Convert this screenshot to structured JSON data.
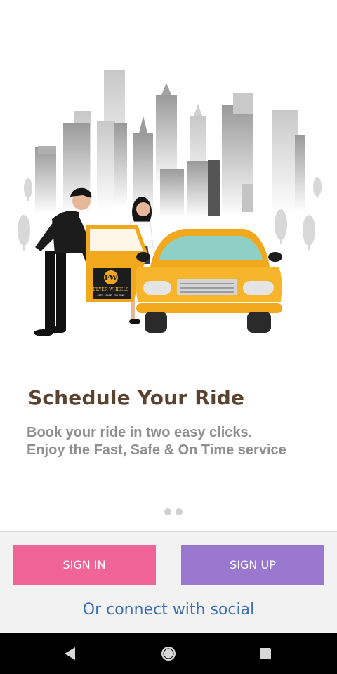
{
  "onboarding": {
    "title": "Schedule Your Ride",
    "description_line1": "Book your ride in two easy clicks.",
    "description_line2": "Enjoy the Fast, Safe & On Time service",
    "illustration_badge": "FW",
    "illustration_brand": "FLYER WHEELS",
    "illustration_tagline": "FAST . SAFE . ON TIME",
    "page_dots": 2
  },
  "actions": {
    "signin_label": "SIGN IN",
    "signup_label": "SIGN UP",
    "social_label": "Or connect with social"
  },
  "colors": {
    "signin": "#f06595",
    "signup": "#9a78d0",
    "title": "#5b4330",
    "social": "#3c6fb5"
  },
  "navbar": {
    "back_icon": "back-triangle-icon",
    "home_icon": "home-circle-icon",
    "recent_icon": "recent-square-icon"
  }
}
